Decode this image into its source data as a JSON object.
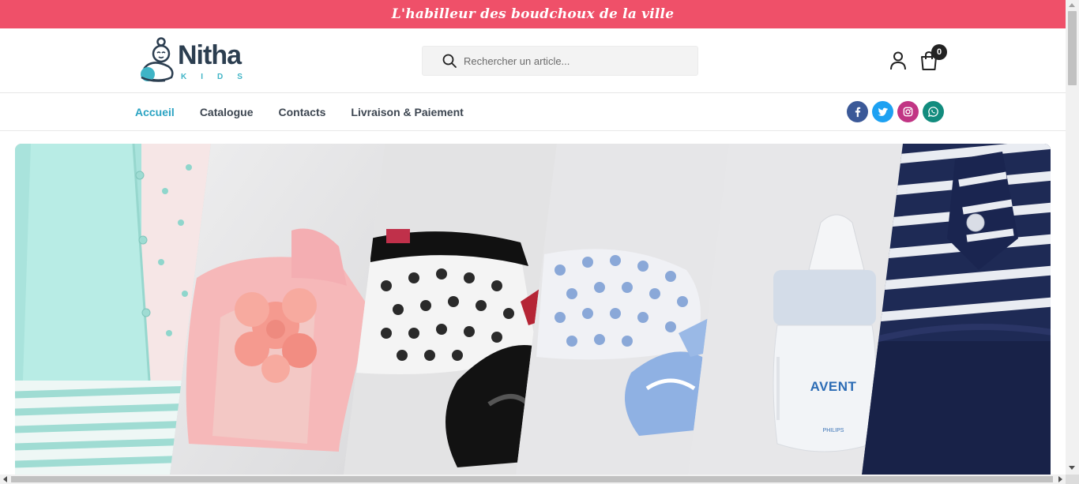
{
  "topbar": {
    "tagline": "L'habilleur des boudchoux de la ville"
  },
  "brand": {
    "name": "Nitha",
    "sub": "KIDS",
    "primary_color": "#2c3e50",
    "accent_color": "#3fb4c6"
  },
  "search": {
    "placeholder": "Rechercher un article...",
    "value": ""
  },
  "header": {
    "account_icon": "user-icon",
    "cart_icon": "shopping-bag-icon",
    "cart_count": "0"
  },
  "nav": {
    "items": [
      {
        "label": "Accueil",
        "active": true
      },
      {
        "label": "Catalogue",
        "active": false
      },
      {
        "label": "Contacts",
        "active": false
      },
      {
        "label": "Livraison & Paiement",
        "active": false
      }
    ],
    "active_color": "#2aa3c2"
  },
  "socials": [
    {
      "name": "facebook-icon",
      "color": "#3b5998"
    },
    {
      "name": "twitter-icon",
      "color": "#1da1f2"
    },
    {
      "name": "instagram-icon",
      "color": "#c13584"
    },
    {
      "name": "whatsapp-icon",
      "color": "#128c7e"
    }
  ],
  "hero": {
    "panels": [
      "mint-cardigan-outfit",
      "pink-flower-sandal",
      "black-heart-baby-shoes",
      "blue-heart-baby-shoes",
      "avent-baby-bottle",
      "navy-striped-dress"
    ],
    "bottle_brand": "AVENT",
    "bottle_maker": "PHILIPS"
  },
  "colors": {
    "topbar": "#ef5069"
  }
}
